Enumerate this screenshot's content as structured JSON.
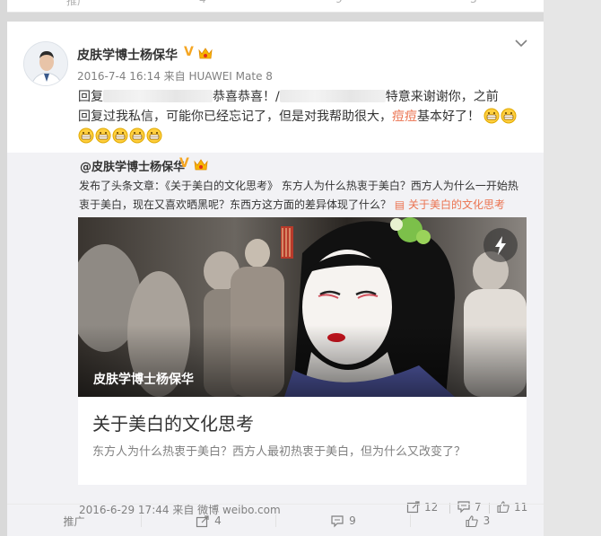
{
  "post": {
    "author": "皮肤学博士杨保华",
    "verified": "V",
    "meta": "2016-7-4 16:14 来自 HUAWEI Mate 8",
    "text_1": "回复",
    "text_2": "恭喜恭喜！/",
    "text_3": "特意来谢谢你，之前",
    "text_4": "回复过我私信，可能你已经忘记了，但是对我帮助很大，",
    "text_red": "痘痘",
    "text_5": "基本好了！"
  },
  "repost": {
    "author": "@皮肤学博士杨保华",
    "verified": "V",
    "text": "发布了头条文章：《关于美白的文化思考》 东方人为什么热衷于美白？西方人为什么一开始热衷于美白，现在又喜欢晒黑呢？东西方这方面的差异体现了什么？",
    "link": "▤ 关于美白的文化思考",
    "article": {
      "caption": "皮肤学博士杨保华",
      "title": "关于美白的文化思考",
      "desc": "东方人为什么热衷于美白？西方人最初热衷于美白，但为什么又改变了？"
    },
    "meta": "2016-6-29 17:44 来自 微博 weibo.com",
    "shares": "12",
    "comments": "7",
    "likes": "11"
  },
  "footer": {
    "promote": "推广",
    "shares": "4",
    "comments": "9",
    "likes": "3"
  },
  "prev_footer": {
    "a": "推广",
    "b": "4",
    "c": "9",
    "d": "3"
  },
  "colors": {
    "accent": "#eb7350",
    "verified": "#f5a623",
    "text_muted": "#808080"
  }
}
